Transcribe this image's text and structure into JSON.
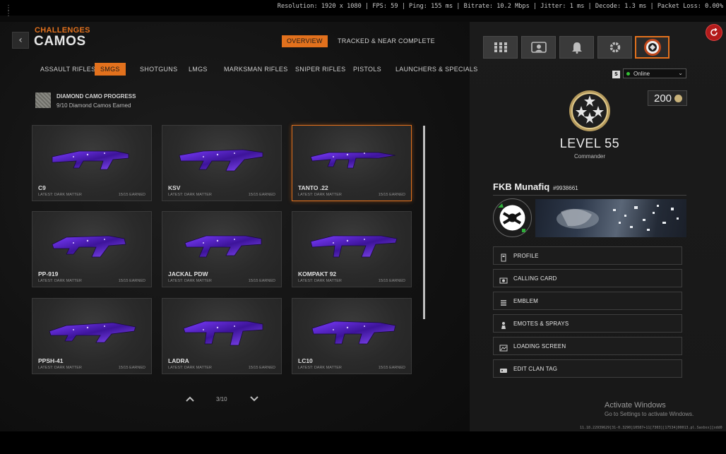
{
  "stats_bar": {
    "text": "Resolution: 1920 x 1080 | FPS: 59 | Ping: 155 ms | Bitrate: 10.2 Mbps | Jitter: 1 ms | Decode: 1.3 ms | Packet Loss: 0.00%"
  },
  "header": {
    "breadcrumb": "CHALLENGES",
    "title": "CAMOS",
    "back_icon": "chevron-left-icon"
  },
  "top_tabs": [
    {
      "label": "OVERVIEW",
      "active": true
    },
    {
      "label": "TRACKED & NEAR COMPLETE",
      "active": false
    }
  ],
  "categories": [
    {
      "label": "ASSAULT RIFLES",
      "active": false
    },
    {
      "label": "SMGS",
      "active": true
    },
    {
      "label": "SHOTGUNS",
      "active": false
    },
    {
      "label": "LMGS",
      "active": false
    },
    {
      "label": "MARKSMAN RIFLES",
      "active": false
    },
    {
      "label": "SNIPER RIFLES",
      "active": false
    },
    {
      "label": "PISTOLS",
      "active": false
    },
    {
      "label": "LAUNCHERS & SPECIALS",
      "active": false
    }
  ],
  "progress": {
    "title": "DIAMOND CAMO PROGRESS",
    "subtitle": "9/10 Diamond Camos Earned"
  },
  "weapons": [
    {
      "name": "C9",
      "latest": "LATEST: DARK MATTER",
      "earned": "15/15 EARNED",
      "selected": false
    },
    {
      "name": "KSV",
      "latest": "LATEST: DARK MATTER",
      "earned": "15/15 EARNED",
      "selected": false
    },
    {
      "name": "TANTO .22",
      "latest": "LATEST: DARK MATTER",
      "earned": "15/15 EARNED",
      "selected": true
    },
    {
      "name": "PP-919",
      "latest": "LATEST: DARK MATTER",
      "earned": "15/15 EARNED",
      "selected": false
    },
    {
      "name": "JACKAL PDW",
      "latest": "LATEST: DARK MATTER",
      "earned": "15/15 EARNED",
      "selected": false
    },
    {
      "name": "KOMPAKT 92",
      "latest": "LATEST: DARK MATTER",
      "earned": "15/15 EARNED",
      "selected": false
    },
    {
      "name": "PPSH-41",
      "latest": "LATEST: DARK MATTER",
      "earned": "15/15 EARNED",
      "selected": false
    },
    {
      "name": "LADRA",
      "latest": "LATEST: DARK MATTER",
      "earned": "15/15 EARNED",
      "selected": false
    },
    {
      "name": "LC10",
      "latest": "LATEST: DARK MATTER",
      "earned": "15/15 EARNED",
      "selected": false
    }
  ],
  "pager": {
    "text": "3/10"
  },
  "right_panel": {
    "icons": [
      "grid-icon",
      "squad-icon",
      "bell-icon",
      "gear-icon",
      "profile-emblem-icon"
    ],
    "status_key": "S",
    "status": "Online",
    "currency_value": "200",
    "level": "LEVEL 55",
    "rank": "Commander",
    "player_name": "FKB Munafiq",
    "player_tag": "#9938661",
    "menu": [
      {
        "label": "PROFILE",
        "icon": "id-card-icon"
      },
      {
        "label": "CALLING CARD",
        "icon": "card-icon"
      },
      {
        "label": "EMBLEM",
        "icon": "emblem-icon"
      },
      {
        "label": "EMOTES & SPRAYS",
        "icon": "emote-icon"
      },
      {
        "label": "LOADING SCREEN",
        "icon": "image-icon"
      },
      {
        "label": "EDIT CLAN TAG",
        "icon": "tag-icon"
      }
    ]
  },
  "watermark": {
    "title": "Activate Windows",
    "subtitle": "Go to Settings to activate Windows.",
    "build": "11.18.22939629[31-0.3290]10587+11[7303][17534]00013.pl.Saxbsx][xdd0"
  },
  "colors": {
    "accent": "#e2711d",
    "camo": "#5a2bd6"
  }
}
